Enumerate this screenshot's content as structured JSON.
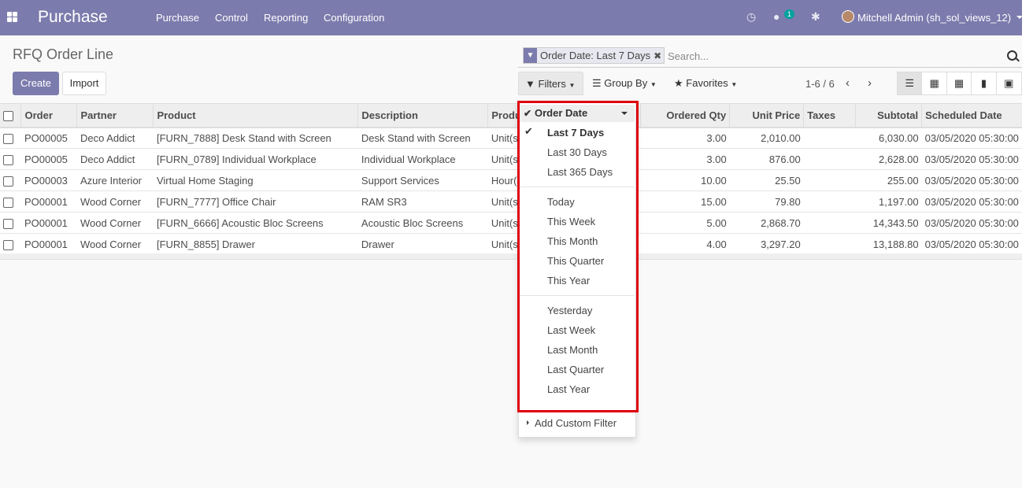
{
  "topbar": {
    "app_title": "Purchase",
    "menu": [
      "Purchase",
      "Control",
      "Reporting",
      "Configuration"
    ],
    "chat_badge": "1",
    "user": "Mitchell Admin (sh_sol_views_12)"
  },
  "breadcrumb": "RFQ Order Line",
  "buttons": {
    "create": "Create",
    "import": "Import"
  },
  "search": {
    "facet_label": "Order Date: Last 7 Days",
    "placeholder": "Search..."
  },
  "filter_bar": {
    "filters": "Filters",
    "group_by": "Group By",
    "favorites": "Favorites"
  },
  "pager": "1-6 / 6",
  "table": {
    "columns": [
      "Order",
      "Partner",
      "Product",
      "Description",
      "Produ",
      "Ordered Qty",
      "Unit Price",
      "Taxes",
      "Subtotal",
      "Scheduled Date"
    ],
    "rows": [
      {
        "order": "PO00005",
        "partner": "Deco Addict",
        "product": "[FURN_7888] Desk Stand with Screen",
        "description": "Desk Stand with Screen",
        "uom": "Unit(s)",
        "qty": "3.00",
        "price": "2,010.00",
        "taxes": "",
        "subtotal": "6,030.00",
        "date": "03/05/2020 05:30:00"
      },
      {
        "order": "PO00005",
        "partner": "Deco Addict",
        "product": "[FURN_0789] Individual Workplace",
        "description": "Individual Workplace",
        "uom": "Unit(s)",
        "qty": "3.00",
        "price": "876.00",
        "taxes": "",
        "subtotal": "2,628.00",
        "date": "03/05/2020 05:30:00"
      },
      {
        "order": "PO00003",
        "partner": "Azure Interior",
        "product": "Virtual Home Staging",
        "description": "Support Services",
        "uom": "Hour(s)",
        "qty": "10.00",
        "price": "25.50",
        "taxes": "",
        "subtotal": "255.00",
        "date": "03/05/2020 05:30:00"
      },
      {
        "order": "PO00001",
        "partner": "Wood Corner",
        "product": "[FURN_7777] Office Chair",
        "description": "RAM SR3",
        "uom": "Unit(s)",
        "qty": "15.00",
        "price": "79.80",
        "taxes": "",
        "subtotal": "1,197.00",
        "date": "03/05/2020 05:30:00"
      },
      {
        "order": "PO00001",
        "partner": "Wood Corner",
        "product": "[FURN_6666] Acoustic Bloc Screens",
        "description": "Acoustic Bloc Screens",
        "uom": "Unit(s)",
        "qty": "5.00",
        "price": "2,868.70",
        "taxes": "",
        "subtotal": "14,343.50",
        "date": "03/05/2020 05:30:00"
      },
      {
        "order": "PO00001",
        "partner": "Wood Corner",
        "product": "[FURN_8855] Drawer",
        "description": "Drawer",
        "uom": "Unit(s)",
        "qty": "4.00",
        "price": "3,297.20",
        "taxes": "",
        "subtotal": "13,188.80",
        "date": "03/05/2020 05:30:00"
      }
    ]
  },
  "dropdown": {
    "group_title": "Order Date",
    "options": [
      "Last 7 Days",
      "Last 30 Days",
      "Last 365 Days",
      "Today",
      "This Week",
      "This Month",
      "This Quarter",
      "This Year",
      "Yesterday",
      "Last Week",
      "Last Month",
      "Last Quarter",
      "Last Year"
    ],
    "add_custom": "Add Custom Filter"
  }
}
